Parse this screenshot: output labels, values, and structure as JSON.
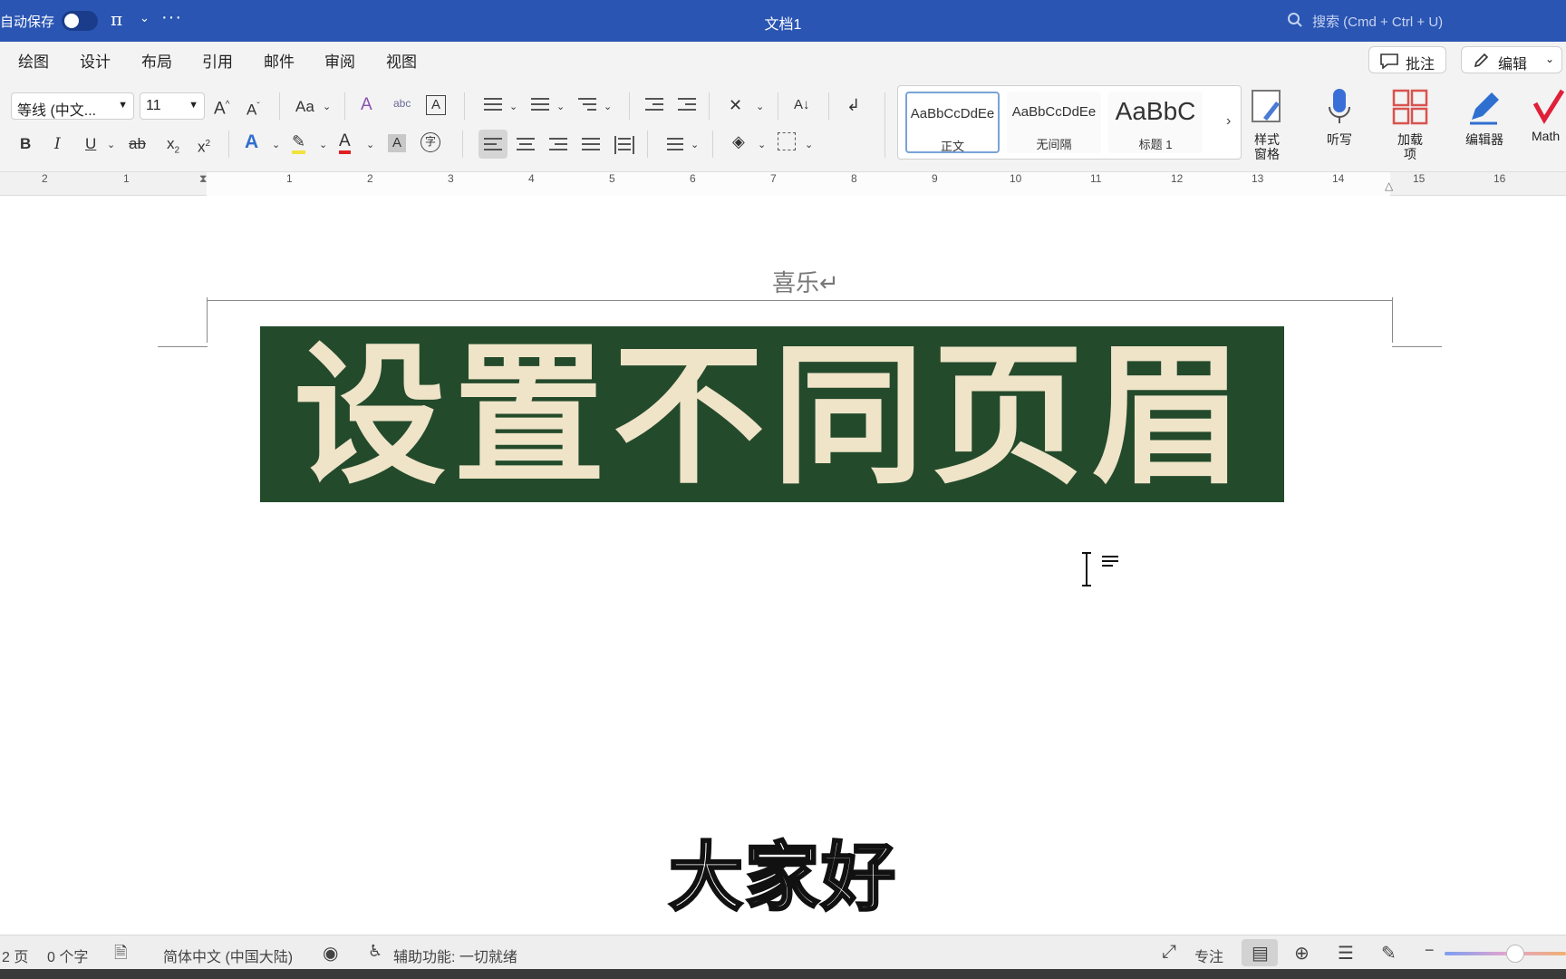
{
  "titlebar": {
    "autosave_label": "自动保存",
    "doc_title": "文档1",
    "search_placeholder": "搜索 (Cmd + Ctrl + U)"
  },
  "menu": {
    "tabs": [
      "绘图",
      "设计",
      "布局",
      "引用",
      "邮件",
      "审阅",
      "视图"
    ],
    "comment_label": "批注",
    "edit_label": "编辑"
  },
  "ribbon": {
    "font_name": "等线 (中文...",
    "font_size": "11",
    "change_case": "Aa",
    "bold": "B",
    "italic": "I",
    "underline": "U",
    "strike": "ab",
    "subscript": "x",
    "superscript": "x",
    "styles": [
      {
        "sample": "AaBbCcDdEe",
        "name": "正文"
      },
      {
        "sample": "AaBbCcDdEe",
        "name": "无间隔"
      },
      {
        "sample": "AaBbC",
        "name": "标题 1"
      }
    ],
    "style_pane_label": "样式\n窗格",
    "dictate_label": "听写",
    "addins_label": "加载\n项",
    "editor_label": "编辑器",
    "math_label": "Math"
  },
  "ruler": {
    "numbers": [
      "2",
      "1",
      "1",
      "2",
      "3",
      "4",
      "5",
      "6",
      "7",
      "8",
      "9",
      "10",
      "11",
      "12",
      "13",
      "14",
      "15",
      "16"
    ]
  },
  "document": {
    "header_text": "喜乐↵",
    "banner_text": "设置不同页眉",
    "subtitle": "大家好"
  },
  "statusbar": {
    "page": "2 页",
    "words": "0 个字",
    "language": "简体中文 (中国大陆)",
    "accessibility": "辅助功能: 一切就绪",
    "focus": "专注",
    "zoom_fraction": 0.58
  },
  "colors": {
    "titlebar": "#2a55b3",
    "banner_bg": "#244a2c",
    "banner_text": "#efe4c8"
  }
}
